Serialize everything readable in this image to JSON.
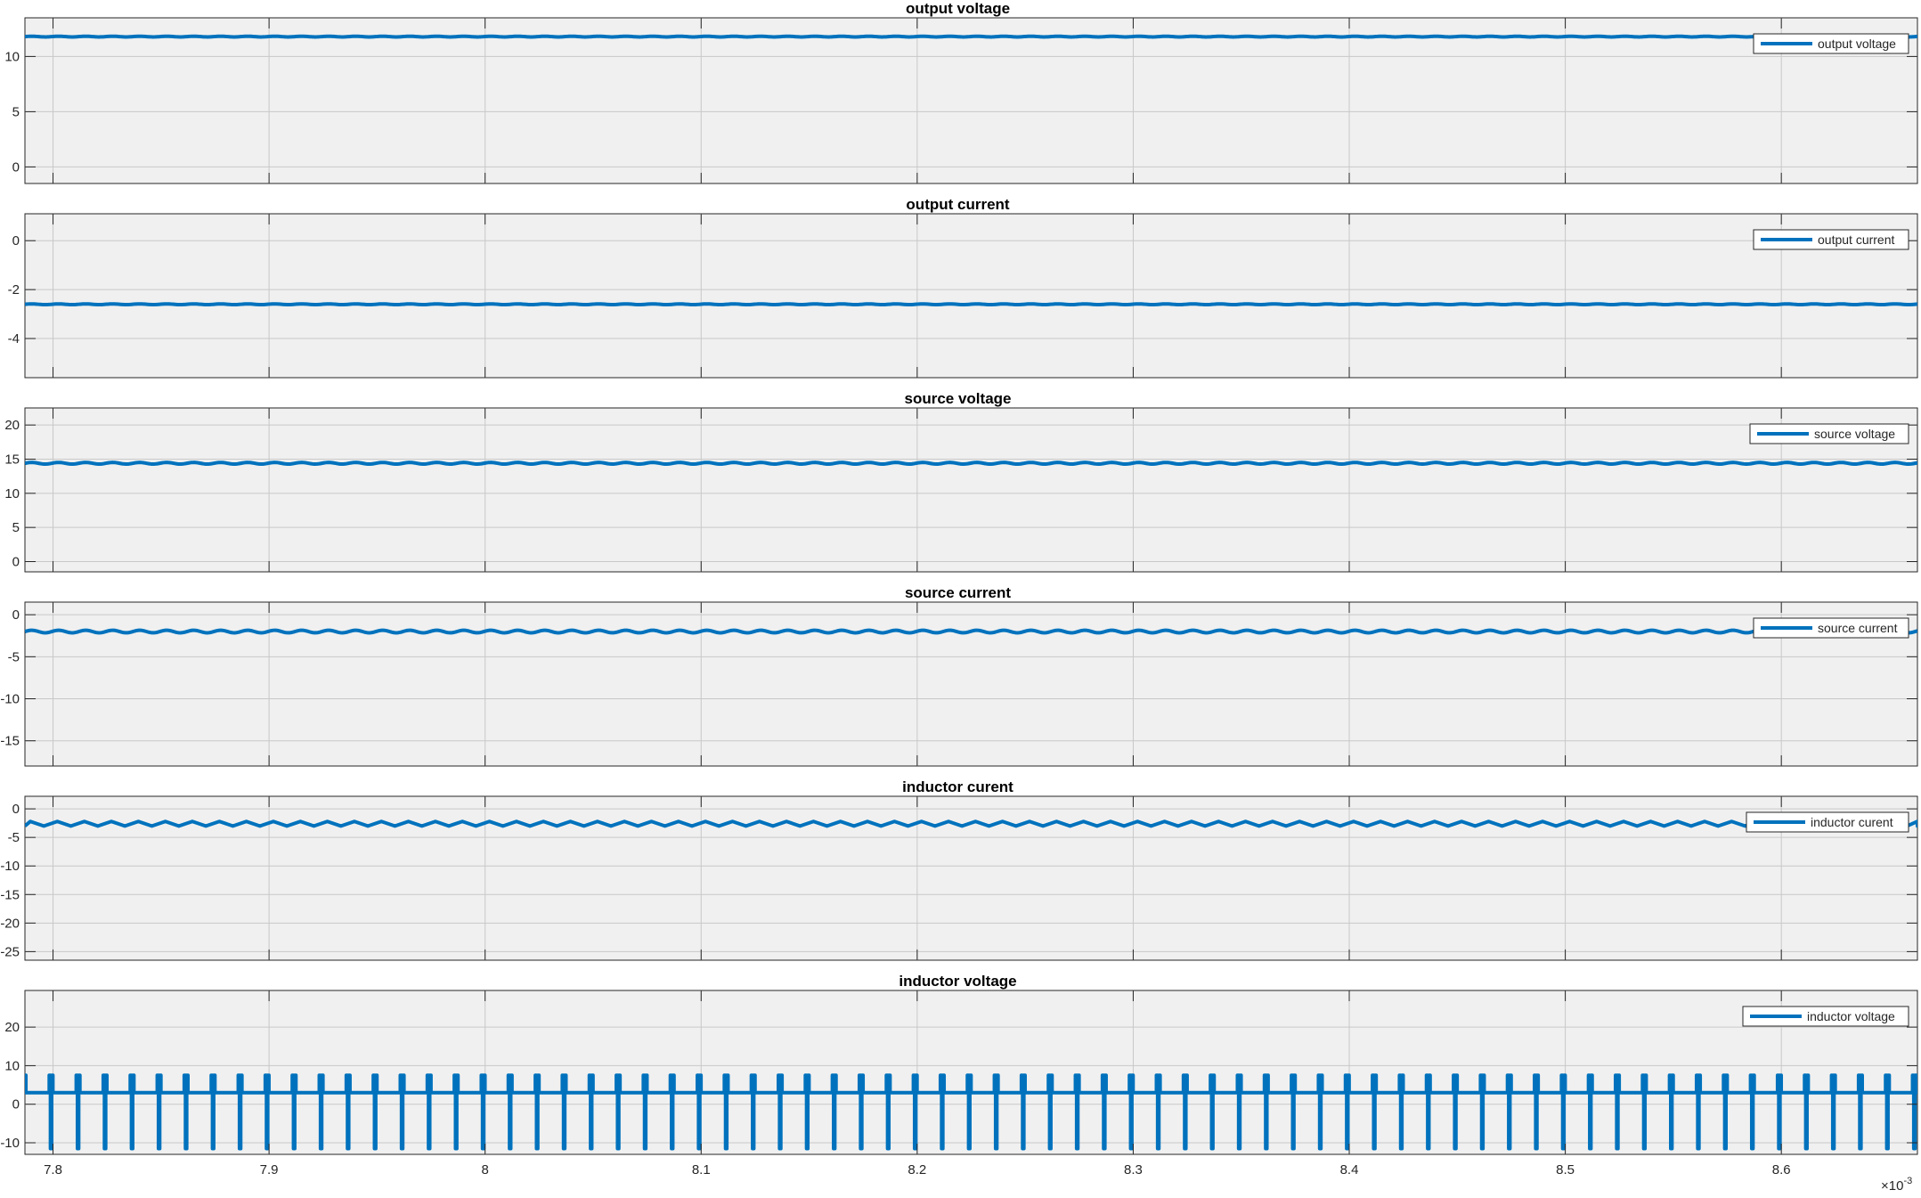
{
  "chart_data": [
    {
      "type": "line",
      "title": "output voltage",
      "xlim": [
        0.007787,
        0.008663
      ],
      "ylim": [
        -1.5,
        13.5
      ],
      "xticks": [
        0.0078,
        0.0079,
        0.008,
        0.0081,
        0.0082,
        0.0083,
        0.0084,
        0.0085,
        0.0086
      ],
      "xticklabels": [
        "7.8",
        "7.9",
        "8",
        "8.1",
        "8.2",
        "8.3",
        "8.4",
        "8.5",
        "8.6"
      ],
      "yticks": [
        0,
        5,
        10
      ],
      "yticklabels": [
        "0",
        "5",
        "10"
      ],
      "grid": true,
      "legend": "top-right",
      "series": [
        {
          "name": "output voltage",
          "color": "#0072bd",
          "waveform": "ripple",
          "mean": 11.8,
          "amplitude": 0.03,
          "period": 1.25e-05
        }
      ]
    },
    {
      "type": "line",
      "title": "output current",
      "xlim": [
        0.007787,
        0.008663
      ],
      "ylim": [
        -5.6,
        1.1
      ],
      "xticks": [
        0.0078,
        0.0079,
        0.008,
        0.0081,
        0.0082,
        0.0083,
        0.0084,
        0.0085,
        0.0086
      ],
      "xticklabels": [
        "7.8",
        "7.9",
        "8",
        "8.1",
        "8.2",
        "8.3",
        "8.4",
        "8.5",
        "8.6"
      ],
      "yticks": [
        -4,
        -2,
        0
      ],
      "yticklabels": [
        "-4",
        "-2",
        "0"
      ],
      "grid": true,
      "legend": "top-right",
      "series": [
        {
          "name": "output current",
          "color": "#0072bd",
          "waveform": "ripple",
          "mean": -2.6,
          "amplitude": 0.015,
          "period": 1.25e-05
        }
      ]
    },
    {
      "type": "line",
      "title": "source voltage",
      "xlim": [
        0.007787,
        0.008663
      ],
      "ylim": [
        -1.5,
        22.5
      ],
      "xticks": [
        0.0078,
        0.0079,
        0.008,
        0.0081,
        0.0082,
        0.0083,
        0.0084,
        0.0085,
        0.0086
      ],
      "xticklabels": [
        "7.8",
        "7.9",
        "8",
        "8.1",
        "8.2",
        "8.3",
        "8.4",
        "8.5",
        "8.6"
      ],
      "yticks": [
        0,
        5,
        10,
        15,
        20
      ],
      "yticklabels": [
        "0",
        "5",
        "10",
        "15",
        "20"
      ],
      "grid": true,
      "legend": "top-right",
      "series": [
        {
          "name": "source voltage",
          "color": "#0072bd",
          "waveform": "ripple",
          "mean": 14.4,
          "amplitude": 0.12,
          "period": 1.25e-05
        }
      ]
    },
    {
      "type": "line",
      "title": "source current",
      "xlim": [
        0.007787,
        0.008663
      ],
      "ylim": [
        -18,
        1.5
      ],
      "xticks": [
        0.0078,
        0.0079,
        0.008,
        0.0081,
        0.0082,
        0.0083,
        0.0084,
        0.0085,
        0.0086
      ],
      "xticklabels": [
        "7.8",
        "7.9",
        "8",
        "8.1",
        "8.2",
        "8.3",
        "8.4",
        "8.5",
        "8.6"
      ],
      "yticks": [
        -15,
        -10,
        -5,
        0
      ],
      "yticklabels": [
        "-15",
        "-10",
        "-5",
        "0"
      ],
      "grid": true,
      "legend": "top-right",
      "series": [
        {
          "name": "source current",
          "color": "#0072bd",
          "waveform": "ripple",
          "mean": -2.0,
          "amplitude": 0.15,
          "period": 1.25e-05
        }
      ]
    },
    {
      "type": "line",
      "title": "inductor curent",
      "xlim": [
        0.007787,
        0.008663
      ],
      "ylim": [
        -26.5,
        2.2
      ],
      "xticks": [
        0.0078,
        0.0079,
        0.008,
        0.0081,
        0.0082,
        0.0083,
        0.0084,
        0.0085,
        0.0086
      ],
      "xticklabels": [
        "7.8",
        "7.9",
        "8",
        "8.1",
        "8.2",
        "8.3",
        "8.4",
        "8.5",
        "8.6"
      ],
      "yticks": [
        -25,
        -20,
        -15,
        -10,
        -5,
        0
      ],
      "yticklabels": [
        "-25",
        "-20",
        "-15",
        "-10",
        "-5",
        "0"
      ],
      "grid": true,
      "legend": "top-right",
      "series": [
        {
          "name": "inductor curent",
          "color": "#0072bd",
          "waveform": "triangle",
          "high": -2.2,
          "low": -3.0,
          "period": 1.25e-05
        }
      ]
    },
    {
      "type": "line",
      "title": "inductor voltage",
      "xlim": [
        0.007787,
        0.008663
      ],
      "ylim": [
        -13,
        29.5
      ],
      "xticks": [
        0.0078,
        0.0079,
        0.008,
        0.0081,
        0.0082,
        0.0083,
        0.0084,
        0.0085,
        0.0086
      ],
      "xticklabels": [
        "7.8",
        "7.9",
        "8",
        "8.1",
        "8.2",
        "8.3",
        "8.4",
        "8.5",
        "8.6"
      ],
      "yticks": [
        -10,
        0,
        10,
        20
      ],
      "yticklabels": [
        "-10",
        "0",
        "10",
        "20"
      ],
      "grid": true,
      "legend": "top-right",
      "series": [
        {
          "name": "inductor voltage",
          "color": "#0072bd",
          "waveform": "switching",
          "base": 3,
          "high": 7.5,
          "low": -11.5,
          "period": 1.25e-05
        }
      ]
    }
  ],
  "x_exponent": {
    "base": "×10",
    "power": "-3"
  }
}
